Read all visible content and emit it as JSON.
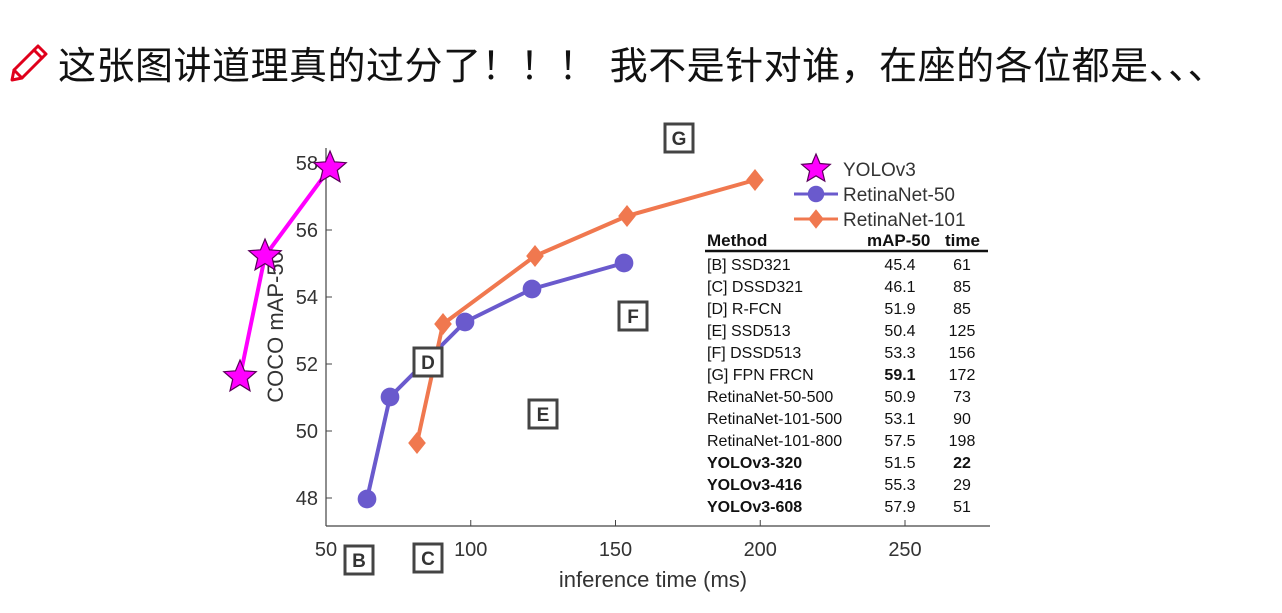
{
  "heading": {
    "text": "这张图讲道理真的过分了！！！ 我不是针对谁，在座的各位都是、、、",
    "icon": "pencil-icon",
    "icon_color": "#e0001b"
  },
  "chart_data": {
    "type": "line",
    "title": "",
    "xlabel": "inference time (ms)",
    "ylabel": "COCO mAP-50",
    "xlim": [
      50,
      280
    ],
    "ylim": [
      47,
      58.2
    ],
    "xticks": [
      50,
      100,
      150,
      200,
      250
    ],
    "yticks": [
      48,
      50,
      52,
      54,
      56,
      58
    ],
    "grid": false,
    "legend_position": "top-right",
    "series": [
      {
        "name": "YOLOv3",
        "marker": "star",
        "color": "#ff00ff",
        "outline": "#5a005a",
        "x": [
          22,
          29,
          51
        ],
        "y": [
          51.5,
          55.3,
          57.9
        ]
      },
      {
        "name": "RetinaNet-50",
        "marker": "circle",
        "color": "#6a5acd",
        "x": [
          73,
          98,
          121,
          153
        ],
        "y": [
          50.9,
          53.1,
          54.2,
          55.0
        ]
      },
      {
        "name": "RetinaNet-101",
        "marker": "diamond",
        "color": "#f0784f",
        "x": [
          90,
          122,
          154,
          198
        ],
        "y": [
          53.1,
          55.1,
          56.3,
          57.5
        ]
      }
    ],
    "series_data_points": {
      "YOLOv3": [
        {
          "x": 22,
          "y": 51.5
        },
        {
          "x": 29,
          "y": 55.3
        },
        {
          "x": 51,
          "y": 57.9
        }
      ],
      "RetinaNet-50": [
        {
          "x": 63,
          "y": 47.8
        },
        {
          "x": 73,
          "y": 50.9
        },
        {
          "x": 98,
          "y": 53.1
        },
        {
          "x": 121,
          "y": 54.2
        },
        {
          "x": 153,
          "y": 55.0
        }
      ],
      "RetinaNet-101": [
        {
          "x": 81,
          "y": 49.5
        },
        {
          "x": 90,
          "y": 53.1
        },
        {
          "x": 122,
          "y": 55.1
        },
        {
          "x": 154,
          "y": 56.3
        },
        {
          "x": 198,
          "y": 57.5
        }
      ]
    },
    "point_labels": [
      {
        "text": "B",
        "x": 61,
        "y": 45.4
      },
      {
        "text": "C",
        "x": 85,
        "y": 46.1
      },
      {
        "text": "D",
        "x": 85,
        "y": 51.9
      },
      {
        "text": "E",
        "x": 125,
        "y": 50.4
      },
      {
        "text": "F",
        "x": 156,
        "y": 53.3
      },
      {
        "text": "G",
        "x": 172,
        "y": 59.1
      }
    ],
    "table": {
      "headers": [
        "Method",
        "mAP-50",
        "time"
      ],
      "rows": [
        {
          "method": "[B] SSD321",
          "map": "45.4",
          "time": "61",
          "bold_method": false,
          "bold_map": false,
          "bold_time": false
        },
        {
          "method": "[C] DSSD321",
          "map": "46.1",
          "time": "85",
          "bold_method": false,
          "bold_map": false,
          "bold_time": false
        },
        {
          "method": "[D] R-FCN",
          "map": "51.9",
          "time": "85",
          "bold_method": false,
          "bold_map": false,
          "bold_time": false
        },
        {
          "method": "[E] SSD513",
          "map": "50.4",
          "time": "125",
          "bold_method": false,
          "bold_map": false,
          "bold_time": false
        },
        {
          "method": "[F] DSSD513",
          "map": "53.3",
          "time": "156",
          "bold_method": false,
          "bold_map": false,
          "bold_time": false
        },
        {
          "method": "[G] FPN FRCN",
          "map": "59.1",
          "time": "172",
          "bold_method": false,
          "bold_map": true,
          "bold_time": false
        },
        {
          "method": "RetinaNet-50-500",
          "map": "50.9",
          "time": "73",
          "bold_method": false,
          "bold_map": false,
          "bold_time": false
        },
        {
          "method": "RetinaNet-101-500",
          "map": "53.1",
          "time": "90",
          "bold_method": false,
          "bold_map": false,
          "bold_time": false
        },
        {
          "method": "RetinaNet-101-800",
          "map": "57.5",
          "time": "198",
          "bold_method": false,
          "bold_map": false,
          "bold_time": false
        },
        {
          "method": "YOLOv3-320",
          "map": "51.5",
          "time": "22",
          "bold_method": true,
          "bold_map": false,
          "bold_time": true
        },
        {
          "method": "YOLOv3-416",
          "map": "55.3",
          "time": "29",
          "bold_method": true,
          "bold_map": false,
          "bold_time": false
        },
        {
          "method": "YOLOv3-608",
          "map": "57.9",
          "time": "51",
          "bold_method": true,
          "bold_map": false,
          "bold_time": false
        }
      ]
    }
  }
}
